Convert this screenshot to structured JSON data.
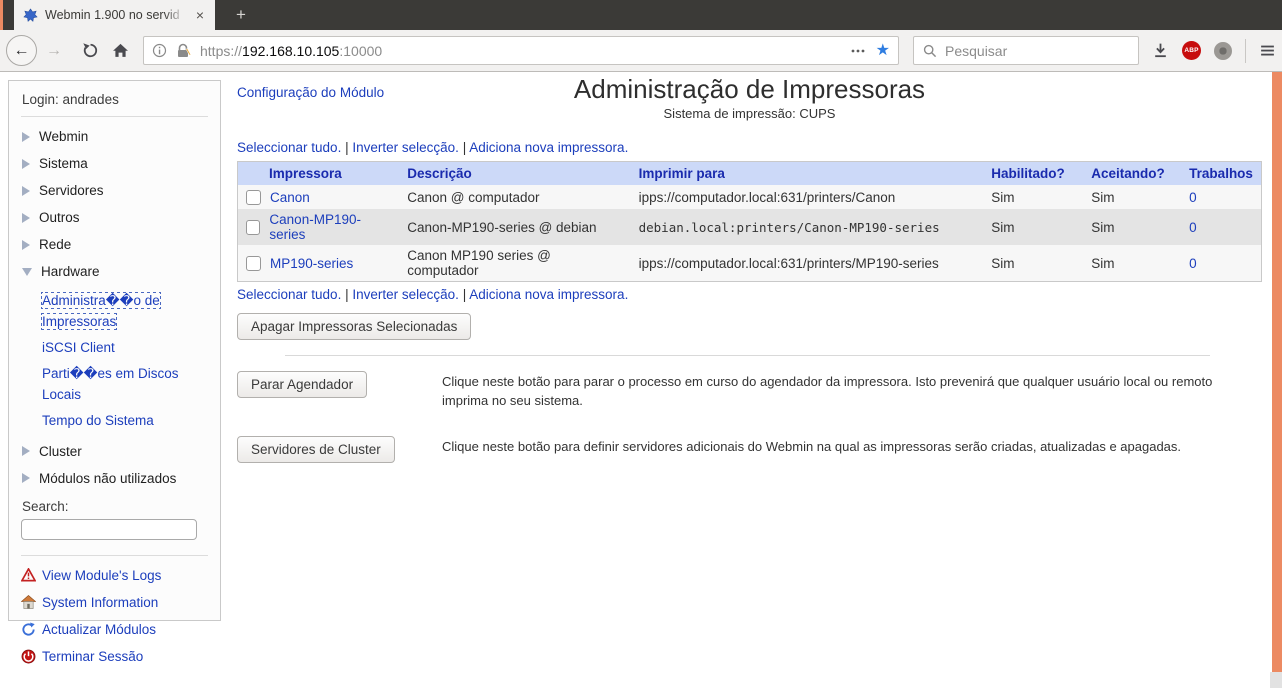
{
  "colors": {
    "accent_orange": "#ec8a62",
    "link_blue": "#1c3ebc",
    "table_header_bg": "#ccd9f8",
    "tabbar_bg": "#3b3a37",
    "toolbar_bg": "#f2f1f0"
  },
  "browser": {
    "tab_title": "Webmin 1.900 no servid",
    "close_glyph": "×",
    "new_tab_glyph": "+",
    "url": {
      "scheme": "https://",
      "host": "192.168.10.105",
      "port": ":10000"
    },
    "back_glyph": "←",
    "forward_glyph": "→",
    "search_placeholder": "Pesquisar",
    "adblock_label": "ABP",
    "star_glyph": "★"
  },
  "sidebar": {
    "login_label": "Login: andrades",
    "items": [
      {
        "label": "Webmin",
        "expanded": false
      },
      {
        "label": "Sistema",
        "expanded": false
      },
      {
        "label": "Servidores",
        "expanded": false
      },
      {
        "label": "Outros",
        "expanded": false
      },
      {
        "label": "Rede",
        "expanded": false
      },
      {
        "label": "Hardware",
        "expanded": true
      },
      {
        "label": "Cluster",
        "expanded": false
      },
      {
        "label": "Módulos não utilizados",
        "expanded": false
      }
    ],
    "hardware_children": [
      {
        "label": "Administra��o de Impressoras",
        "focused": true
      },
      {
        "label": "iSCSI Client",
        "focused": false
      },
      {
        "label": "Parti��es em Discos Locais",
        "focused": false
      },
      {
        "label": "Tempo do Sistema",
        "focused": false
      }
    ],
    "search_label": "Search:",
    "footer_links": [
      {
        "label": "View Module's Logs",
        "icon": "warning-triangle-icon"
      },
      {
        "label": "System Information",
        "icon": "home-icon"
      },
      {
        "label": "Actualizar Módulos",
        "icon": "refresh-icon"
      },
      {
        "label": "Terminar Sessão",
        "icon": "power-icon"
      }
    ]
  },
  "main": {
    "module_config_link": "Configuração do Módulo",
    "title": "Administração de Impressoras",
    "subtitle": "Sistema de impressão: CUPS",
    "links": {
      "select_all": "Seleccionar tudo.",
      "invert": "Inverter selecção.",
      "add_printer": "Adiciona nova impressora.",
      "separator": "|"
    },
    "table": {
      "headers": {
        "printer": "Impressora",
        "description": "Descrição",
        "print_to": "Imprimir para",
        "enabled": "Habilitado?",
        "accepting": "Aceitando?",
        "jobs": "Trabalhos"
      },
      "rows": [
        {
          "name": "Canon",
          "description": "Canon @ computador",
          "print_to": "ipps://computador.local:631/printers/Canon",
          "enabled": "Sim",
          "accepting": "Sim",
          "jobs": "0"
        },
        {
          "name": "Canon-MP190-series",
          "description": "Canon-MP190-series @ debian",
          "print_to": "debian.local:printers/Canon-MP190-series",
          "enabled": "Sim",
          "accepting": "Sim",
          "jobs": "0"
        },
        {
          "name": "MP190-series",
          "description": "Canon MP190 series @ computador",
          "print_to": "ipps://computador.local:631/printers/MP190-series",
          "enabled": "Sim",
          "accepting": "Sim",
          "jobs": "0"
        }
      ]
    },
    "delete_button": "Apagar Impressoras Selecionadas",
    "actions": [
      {
        "button": "Parar Agendador",
        "description": "Clique neste botão para parar o processo em curso do agendador da impressora. Isto prevenirá que qualquer usuário local ou remoto imprima no seu sistema."
      },
      {
        "button": "Servidores de Cluster",
        "description": "Clique neste botão para definir servidores adicionais do Webmin na qual as impressoras serão criadas, atualizadas e apagadas."
      }
    ]
  }
}
